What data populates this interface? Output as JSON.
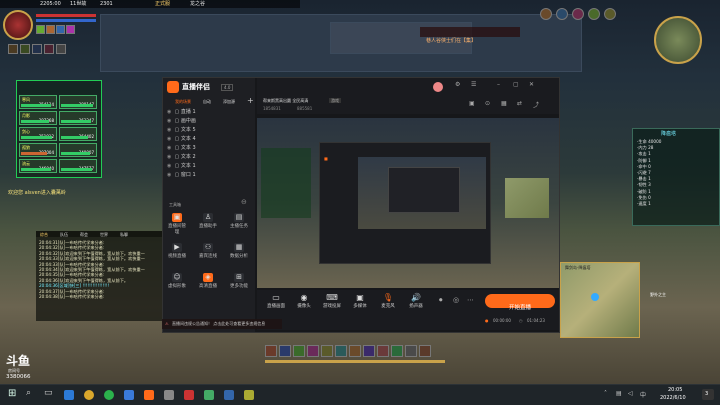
{
  "game": {
    "top_info": [
      "2205:00",
      "11世故",
      "2301",
      "正式服",
      "龙之谷",
      "10",
      "35"
    ],
    "top_notice": "巷人谷侠士们在【集】",
    "system_msg": "欢迎您 alsven进入囊萬岭",
    "party": [
      {
        "name": "寒风",
        "hp": "354134",
        "mp": "380147"
      },
      {
        "name": "月影",
        "hp": "387268",
        "mp": "363247"
      },
      {
        "name": "剑心",
        "hp": "351912",
        "mp": "364402"
      },
      {
        "name": "孤狼",
        "hp": "307004",
        "mp": "340007"
      },
      {
        "name": "流云",
        "hp": "346040",
        "mp": "347577"
      }
    ],
    "chat_lines": [
      "20:04:31[队]一布哈传代学来分者:",
      "20:04:32[队]一布哈传代学来分者:",
      "20:04:32[队]欢迎来到下午值得练，宽从前下。欢快重一",
      "20:04:33[队]欢迎来到下午值得练，宽从前下。欢快重一",
      "20:04:33[队]一布哈传代学来分者:",
      "20:04:34[队]欢迎来到下午值得练，宽从前下。欢快重一",
      "20:04:35[队]一布哈传代学来分者:",
      "20:04:36[队]欢迎来到下午值得练，宽从前下。",
      "20:04:36[区域]快[三] !!!!!!!!!!!!!!!!",
      "20:04:37[队]一布哈传代学来分者:",
      "20:04:38[队]一布哈传代学来分者:"
    ],
    "chat_tabs": [
      "综合",
      "队伍",
      "帮会",
      "世界",
      "私聊"
    ],
    "right_panel_title": "降瘟塔",
    "right_stats": [
      {
        "k": "生命",
        "v": "40000"
      },
      {
        "k": "内力",
        "v": "28"
      },
      {
        "k": "攻击",
        "v": "1"
      },
      {
        "k": "防御",
        "v": "1"
      },
      {
        "k": "命中",
        "v": "0"
      },
      {
        "k": "闪避",
        "v": "7"
      },
      {
        "k": "暴击",
        "v": "1"
      },
      {
        "k": "韧性",
        "v": "3"
      },
      {
        "k": "破防",
        "v": "1"
      },
      {
        "k": "免伤",
        "v": "0"
      },
      {
        "k": "速度",
        "v": "1"
      }
    ],
    "map_label": "舞剑岛-降瘟塔",
    "target_name": "野外之主",
    "logo_name": "斗鱼",
    "logo_sub": "房间号",
    "logo_id": "3380066"
  },
  "app": {
    "logo": "直播伴侣",
    "version": "4.0",
    "tabs": [
      "我的场景",
      "自动",
      "添加源"
    ],
    "scene_items": [
      "直播 1",
      "画中画",
      "文本 5",
      "文本 4",
      "文本 3",
      "文本 2",
      "文本 1",
      "窗口 1"
    ],
    "tool_section": "工具箱",
    "tools": [
      {
        "label": "直播间管理",
        "icon": "▣"
      },
      {
        "label": "直播助手",
        "icon": "♙"
      },
      {
        "label": "主播任务",
        "icon": "▤"
      },
      {
        "label": "视频直播",
        "icon": "▶"
      },
      {
        "label": "嘉宾连线",
        "icon": "⚇"
      },
      {
        "label": "数据分析",
        "icon": "▦"
      },
      {
        "label": "虚拟形象",
        "icon": "☺"
      },
      {
        "label": "高清直播",
        "icon": "◈"
      },
      {
        "label": "更多功能",
        "icon": "⊞"
      }
    ],
    "stream_title": "帮来斯黑高出圆 全民高清",
    "stream_tag": "游戏",
    "room_no": "1854831",
    "fans": "885581",
    "bottom_tools": [
      {
        "label": "直播画面",
        "icon": "▭"
      },
      {
        "label": "摄像头",
        "icon": "◉"
      },
      {
        "label": "游戏投屏",
        "icon": "⌨"
      },
      {
        "label": "多媒体",
        "icon": "▣"
      },
      {
        "label": "麦克风",
        "icon": "🎙"
      },
      {
        "label": "扬声器",
        "icon": "🔊"
      }
    ],
    "start_button": "开始直播",
    "time_left": "00:00:00",
    "time_right": "01:04:23",
    "notice": "直播间违规公告通知！ 点击此处可查看更多违规信息"
  },
  "taskbar": {
    "time": "20:05",
    "date": "2022/6/10",
    "lang": "中",
    "notif_count": "3"
  },
  "colors": {
    "accent": "#ff6a1a",
    "app_bg": "#16171a",
    "taskbar": "#1f2529"
  }
}
